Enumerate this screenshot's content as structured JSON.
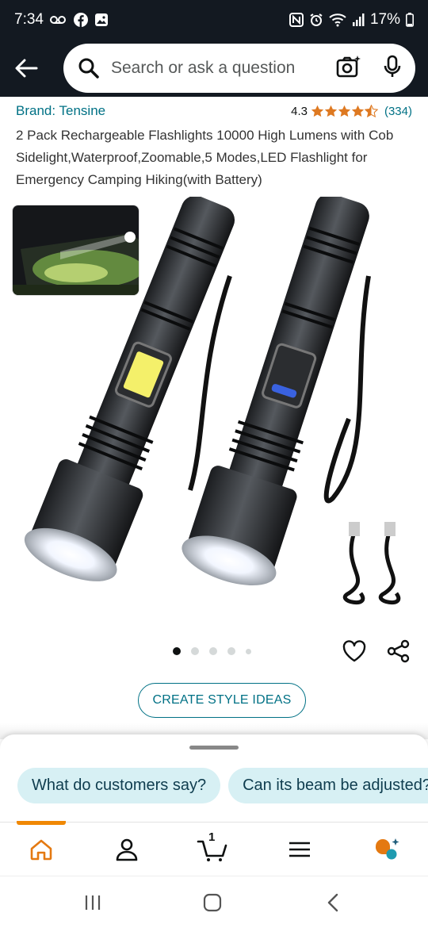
{
  "status_bar": {
    "time": "7:34",
    "battery": "17%"
  },
  "search": {
    "placeholder": "Search or ask a question"
  },
  "product": {
    "brand": "Brand: Tensine",
    "rating": "4.3",
    "review_count": "(334)",
    "rating_value": 4.3,
    "title": "2 Pack Rechargeable Flashlights 10000 High Lumens with Cob Sidelight,Waterproof,Zoomable,5 Modes,LED Flashlight for Emergency Camping Hiking(with Battery)"
  },
  "gallery": {
    "image_count": 5,
    "active_index": 0
  },
  "actions": {
    "style_ideas": "CREATE STYLE IDEAS"
  },
  "suggestions": [
    {
      "label": "What do customers say?"
    },
    {
      "label": "Can its beam be adjusted?"
    }
  ],
  "cart": {
    "count": "1"
  },
  "colors": {
    "header_bg": "#131921",
    "link": "#007185",
    "star": "#de7921",
    "nav_accent": "#f08804",
    "chip_bg": "#d7f0f4"
  }
}
